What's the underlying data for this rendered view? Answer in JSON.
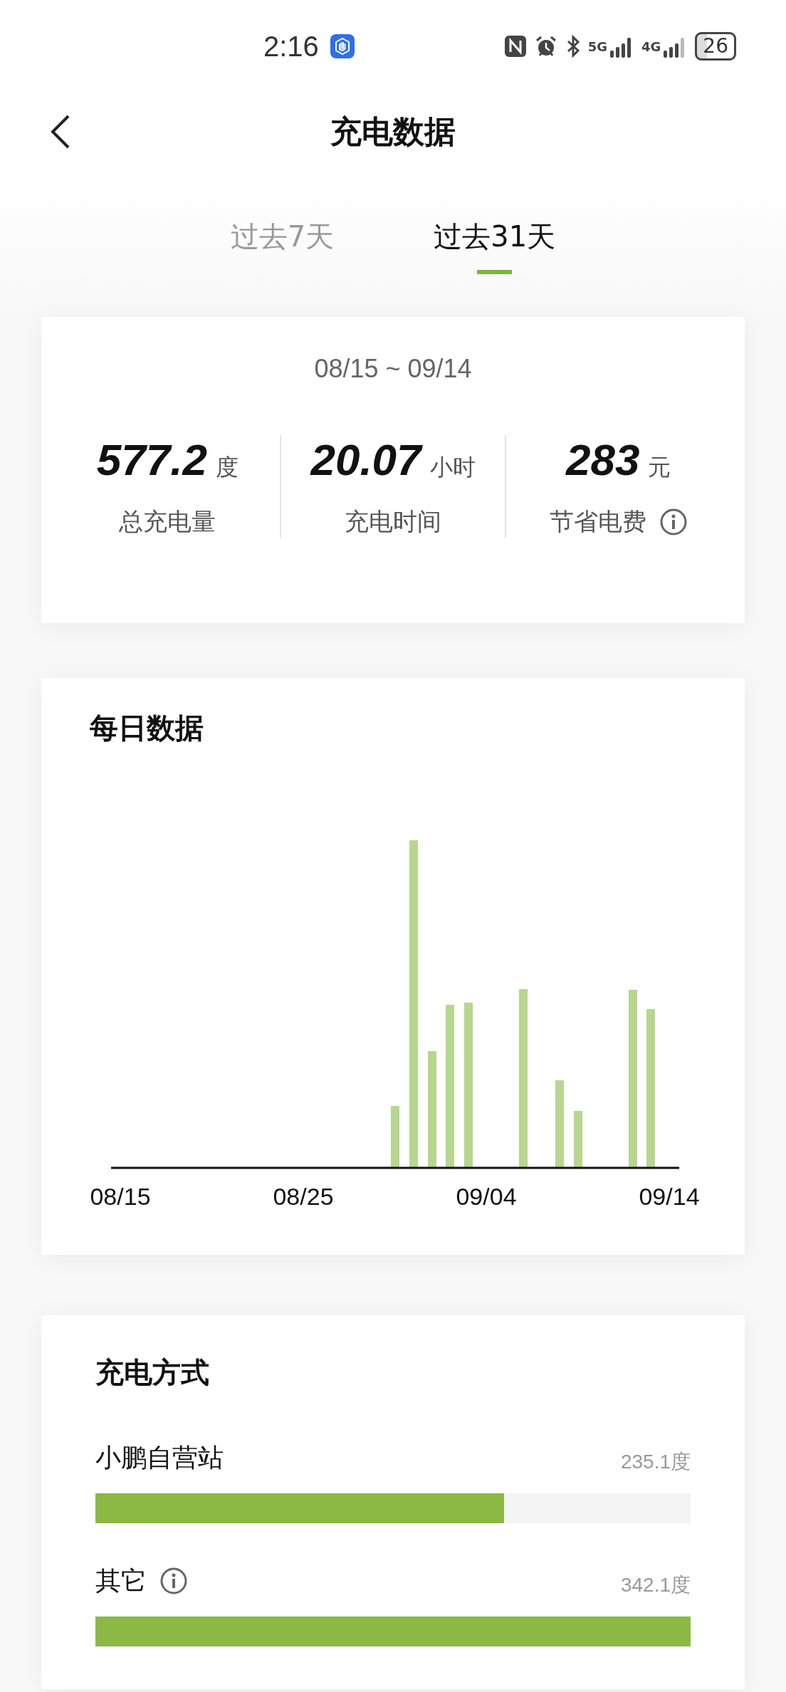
{
  "status_bar": {
    "time": "2:16",
    "network_1": "5G",
    "network_2": "4G",
    "battery": "26"
  },
  "header": {
    "title": "充电数据"
  },
  "tabs": [
    {
      "label": "过去7天",
      "selected": false
    },
    {
      "label": "过去31天",
      "selected": true
    }
  ],
  "summary": {
    "date_range": "08/15 ~ 09/14",
    "stats": [
      {
        "value": "577.2",
        "unit": "度",
        "label": "总充电量",
        "info": false
      },
      {
        "value": "20.07",
        "unit": "小时",
        "label": "充电时间",
        "info": false
      },
      {
        "value": "283",
        "unit": "元",
        "label": "节省电费",
        "info": true
      }
    ]
  },
  "daily": {
    "title": "每日数据",
    "x_labels": [
      "08/15",
      "08/25",
      "09/04",
      "09/14"
    ]
  },
  "methods": {
    "title": "充电方式",
    "items": [
      {
        "name": "小鹏自营站",
        "info": false,
        "reading": "235.1度",
        "level": 0.687
      },
      {
        "name": "其它",
        "info": true,
        "reading": "342.1度",
        "level": 1.0
      }
    ]
  }
}
